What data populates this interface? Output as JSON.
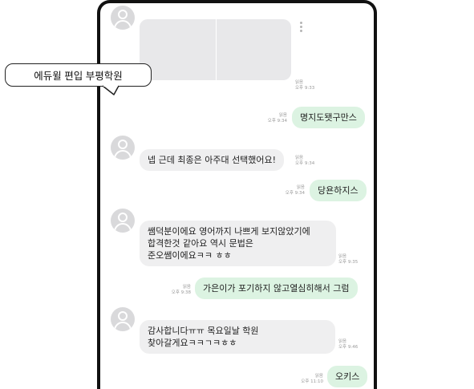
{
  "callout": {
    "text": "에듀윌 편입 부평학원"
  },
  "messages": [
    {
      "meta": "읽음\n오후 9:33"
    },
    {
      "text": "명지도됏구만스",
      "meta": "읽음\n오후 9:34"
    },
    {
      "text": "넵 근데 최종은 아주대 선택했어요!",
      "meta": "읽음\n오후 9:34"
    },
    {
      "text": "당욘하지스",
      "meta": "읽음\n오후 9:34"
    },
    {
      "text": "쌤덕분이에요 영어까지 나쁘게 보지않았기에\n합격한것 같아요 역시 문법은\n준오쌤이에요ㅋㅋ ㅎㅎ",
      "meta": "읽음\n오후 9:35"
    },
    {
      "text": "가은이가 포기하지 않고열심히해서 그럼",
      "meta": "읽음\n오후 9:38"
    },
    {
      "text": "감사합니다ㅠㅠ 목요일날 학원\n찾아갈게요ㅋㅋㄱㅋㅎㅎ",
      "meta": "읽음\n오후 9:46"
    },
    {
      "text": "오키스",
      "meta": "읽음\n오후 11:10"
    }
  ],
  "colors": {
    "incoming_bubble": "#efeff0",
    "outgoing_bubble": "#dcf3e2",
    "avatar": "#d9d9db"
  }
}
